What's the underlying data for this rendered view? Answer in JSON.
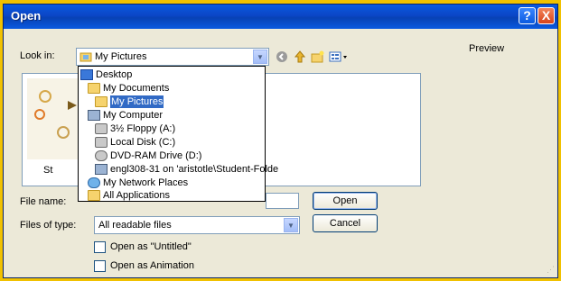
{
  "window": {
    "title": "Open"
  },
  "titlebar_buttons": {
    "help": "?",
    "close": "X"
  },
  "lookin": {
    "label": "Look in:",
    "value": "My Pictures",
    "dropdown_arrow": "▼"
  },
  "toolbar": {
    "back_icon": "back-icon",
    "up_icon": "up-folder-icon",
    "new_folder_icon": "new-folder-icon",
    "views_icon": "views-menu-icon"
  },
  "preview": {
    "label": "Preview"
  },
  "file_item": {
    "label_partial": "St"
  },
  "dropdown": {
    "items": [
      {
        "label": "Desktop",
        "icon": "desktop-icon",
        "selected": false
      },
      {
        "label": "My Documents",
        "icon": "folder-icon",
        "selected": false
      },
      {
        "label": "My Pictures",
        "icon": "folder-icon",
        "selected": true
      },
      {
        "label": "My Computer",
        "icon": "computer-icon",
        "selected": false
      },
      {
        "label": "3½ Floppy (A:)",
        "icon": "floppy-icon",
        "selected": false
      },
      {
        "label": "Local Disk (C:)",
        "icon": "disk-icon",
        "selected": false
      },
      {
        "label": "DVD-RAM Drive (D:)",
        "icon": "dvd-icon",
        "selected": false
      },
      {
        "label": "engl308-31 on 'aristotle\\Student-Folde",
        "icon": "network-drive-icon",
        "selected": false
      },
      {
        "label": "My Network Places",
        "icon": "network-icon",
        "selected": false
      },
      {
        "label": "All Applications",
        "icon": "folder-icon",
        "selected": false
      }
    ]
  },
  "filename": {
    "label": "File name:",
    "value": ""
  },
  "filetype": {
    "label": "Files of type:",
    "value": "All readable files",
    "dropdown_arrow": "▼"
  },
  "buttons": {
    "open": "Open",
    "cancel": "Cancel"
  },
  "options": {
    "untitled": {
      "label": "Open as \"Untitled\"",
      "checked": false
    },
    "animation": {
      "label": "Open as Animation",
      "checked": false
    }
  }
}
